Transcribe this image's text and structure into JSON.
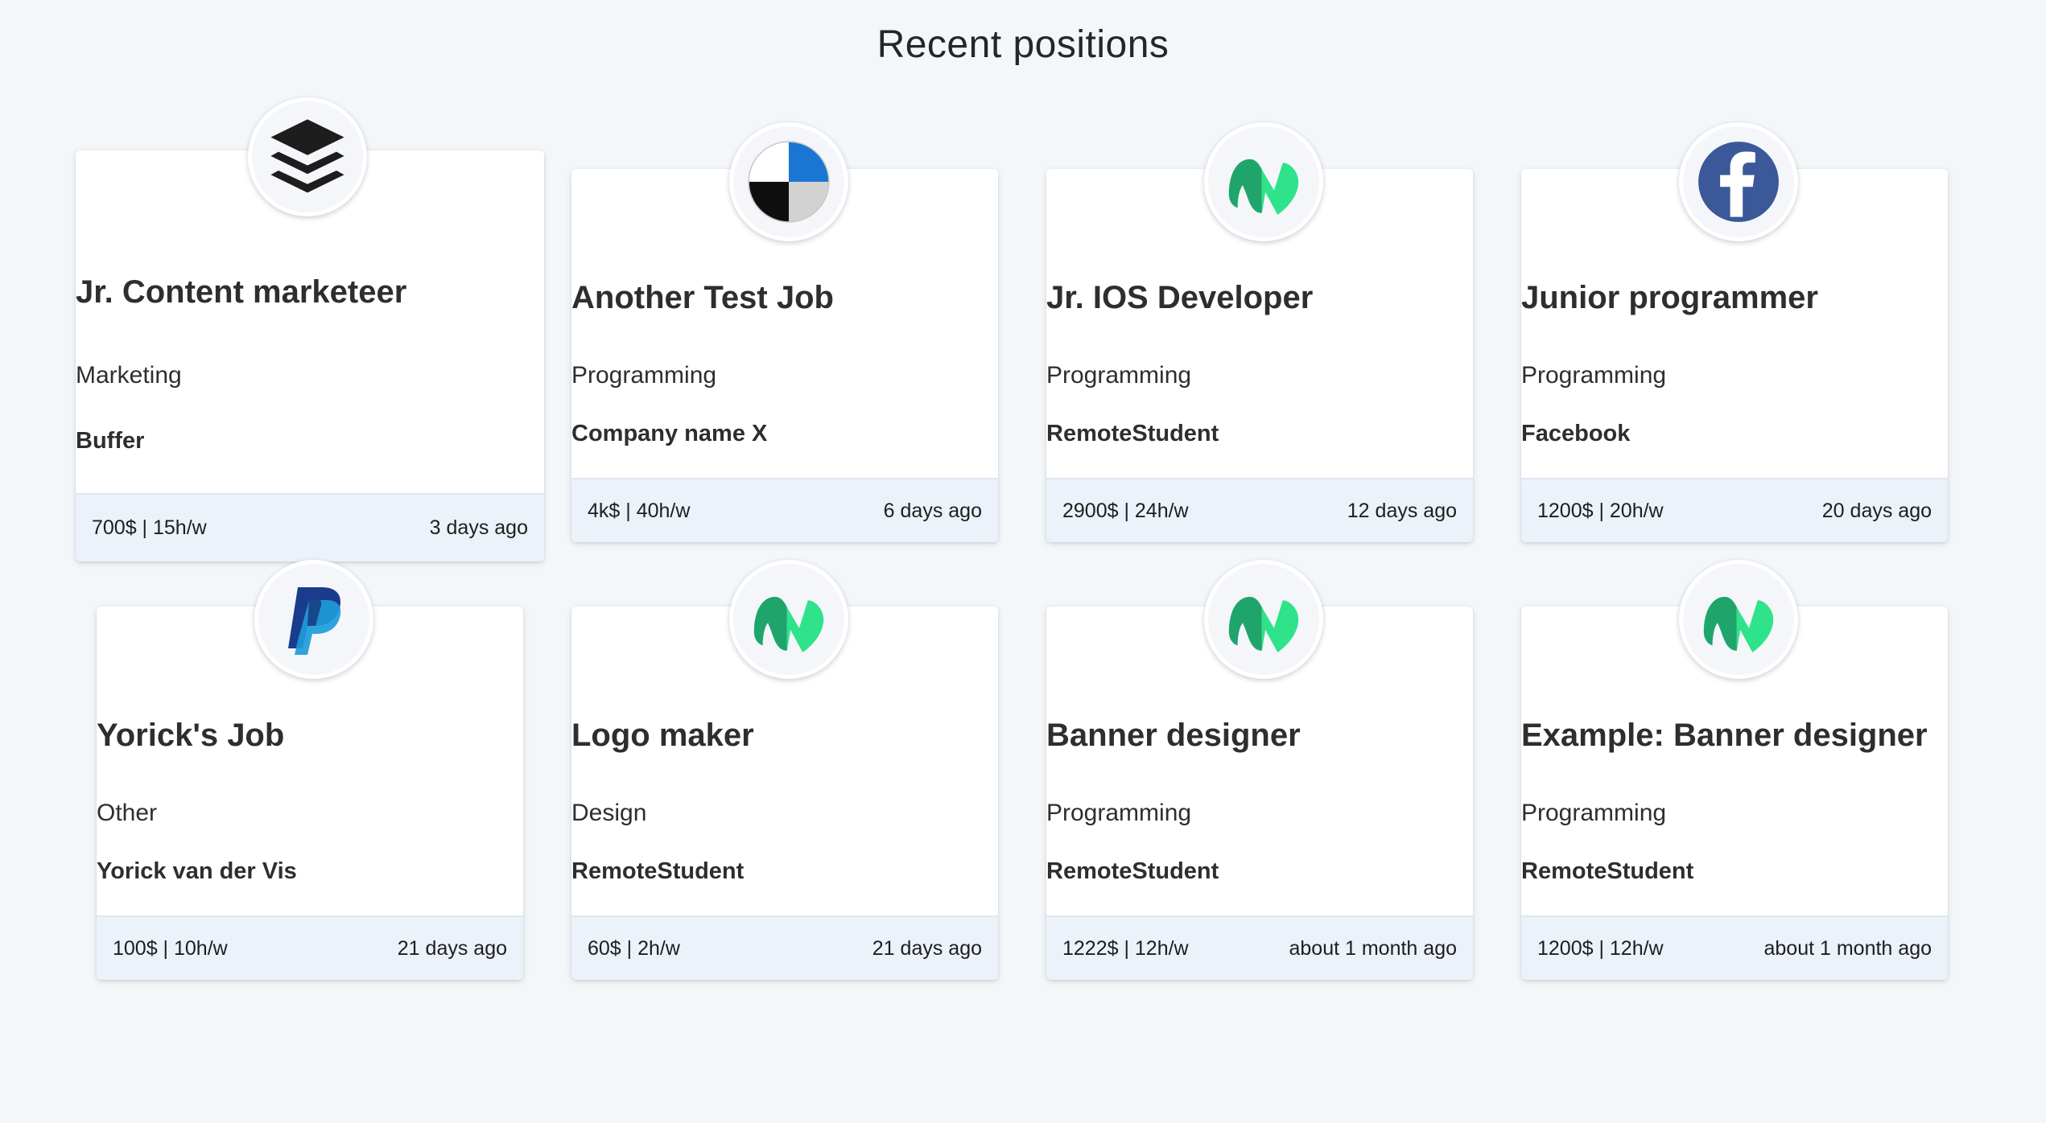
{
  "header": {
    "title": "Recent positions"
  },
  "jobs": [
    {
      "title": "Jr. Content marketeer",
      "category": "Marketing",
      "company": "Buffer",
      "pay": "700$ | 15h/w",
      "posted": "3 days ago",
      "logo": "buffer-logo"
    },
    {
      "title": "Another Test Job",
      "category": "Programming",
      "company": "Company name X",
      "pay": "4k$ | 40h/w",
      "posted": "6 days ago",
      "logo": "quadrant-logo"
    },
    {
      "title": "Jr. IOS Developer",
      "category": "Programming",
      "company": "RemoteStudent",
      "pay": "2900$ | 24h/w",
      "posted": "12 days ago",
      "logo": "remotestudent-logo"
    },
    {
      "title": "Junior programmer",
      "category": "Programming",
      "company": "Facebook",
      "pay": "1200$ | 20h/w",
      "posted": "20 days ago",
      "logo": "facebook-logo"
    },
    {
      "title": "Yorick's Job",
      "category": "Other",
      "company": "Yorick van der Vis",
      "pay": "100$ | 10h/w",
      "posted": "21 days ago",
      "logo": "paypal-logo"
    },
    {
      "title": "Logo maker",
      "category": "Design",
      "company": "RemoteStudent",
      "pay": "60$ | 2h/w",
      "posted": "21 days ago",
      "logo": "remotestudent-logo"
    },
    {
      "title": "Banner designer",
      "category": "Programming",
      "company": "RemoteStudent",
      "pay": "1222$ | 12h/w",
      "posted": "about 1 month ago",
      "logo": "remotestudent-logo"
    },
    {
      "title": "Example: Banner designer",
      "category": "Programming",
      "company": "RemoteStudent",
      "pay": "1200$ | 12h/w",
      "posted": "about 1 month ago",
      "logo": "remotestudent-logo"
    }
  ],
  "colors": {
    "background": "#f4f7fa",
    "card": "#ffffff",
    "footer": "#ecf2fa",
    "remotestudent_green_dark": "#1fa56b",
    "remotestudent_green_light": "#2fe38a",
    "facebook_blue": "#3b5998",
    "paypal_dark": "#1b3b8c",
    "paypal_light": "#1d9bd9",
    "quadrant_blue": "#1976d2"
  }
}
